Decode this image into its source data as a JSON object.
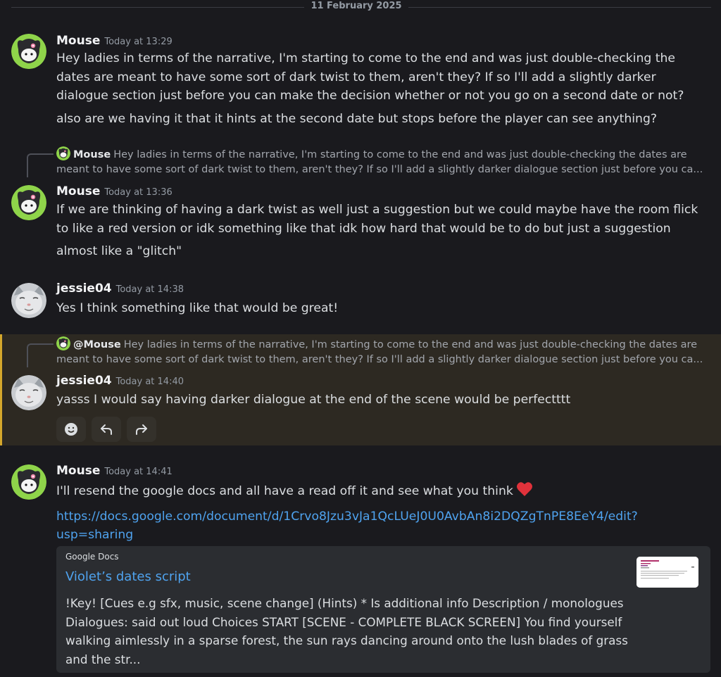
{
  "date_divider": "11 February 2025",
  "colors": {
    "background": "#1a1a1e",
    "highlight_bg": "#2d2922",
    "highlight_border": "#d4a72c",
    "link": "#4fa3ef",
    "embed_bg": "#2b2d31"
  },
  "messages": [
    {
      "username": "Mouse",
      "timestamp": "Today at 13:29",
      "avatar_icon": "kuromi-avatar-icon",
      "lines": [
        "Hey ladies in terms of the narrative, I'm starting to come to the end and was just double-checking the dates are meant to have some sort of dark twist to them, aren't they? If so I'll add a slightly darker dialogue section just before you can make the decision whether or not you go on a second date or not?",
        "also are we having it that it hints at the second date but stops before the player can see anything?"
      ]
    },
    {
      "reply": {
        "username": "Mouse",
        "text": "Hey ladies in terms of the narrative, I'm starting to come to the end and was just double-checking the dates are meant to have some sort of dark twist to them, aren't they? If so I'll add a slightly darker dialogue section just before you ca..."
      },
      "username": "Mouse",
      "timestamp": "Today at 13:36",
      "avatar_icon": "kuromi-avatar-icon",
      "lines": [
        "If we are thinking of having a dark twist as well just a suggestion but we could maybe have the room flick to like a red version or idk something like that idk how hard that would be to do but just a suggestion",
        "almost like a \"glitch\""
      ]
    },
    {
      "username": "jessie04",
      "timestamp": "Today at 14:38",
      "avatar_icon": "cat-avatar-icon",
      "lines": [
        "Yes I think something like that would be great!"
      ]
    },
    {
      "reply": {
        "username": "@Mouse",
        "text": "Hey ladies in terms of the narrative, I'm starting to come to the end and was just double-checking the dates are meant to have some sort of dark twist to them, aren't they? If so I'll add a slightly darker dialogue section just before you ca..."
      },
      "username": "jessie04",
      "timestamp": "Today at 14:40",
      "avatar_icon": "cat-avatar-icon",
      "lines": [
        "yasss I would say having darker dialogue at the end of the scene would be perfectttt"
      ],
      "actions": [
        "add-reaction-icon",
        "reply-icon",
        "forward-icon"
      ]
    },
    {
      "username": "Mouse",
      "timestamp": "Today at 14:41",
      "avatar_icon": "kuromi-avatar-icon",
      "lines": [
        "I'll resend the google docs and all have a read off it and see what you think"
      ],
      "emoji": "red-heart-icon",
      "link": "https://docs.google.com/document/d/1Crvo8Jzu3vJa1QcLUeJ0U0AvbAn8i2DQZgTnPE8EeY4/edit?usp=sharing",
      "embed": {
        "provider": "Google Docs",
        "title": "Violet’s dates script",
        "description": "!Key!  [Cues e.g sfx, music, scene change] (Hints) * Is additional info Description / monologues Dialogues: said out loud Choices  START  [SCENE - COMPLETE BLACK SCREEN]  You find yourself walking aimlessly in a sparse forest, the sun rays dancing around onto the lush blades of grass and the str...",
        "thumbnail_icon": "document-thumbnail-icon"
      }
    }
  ]
}
